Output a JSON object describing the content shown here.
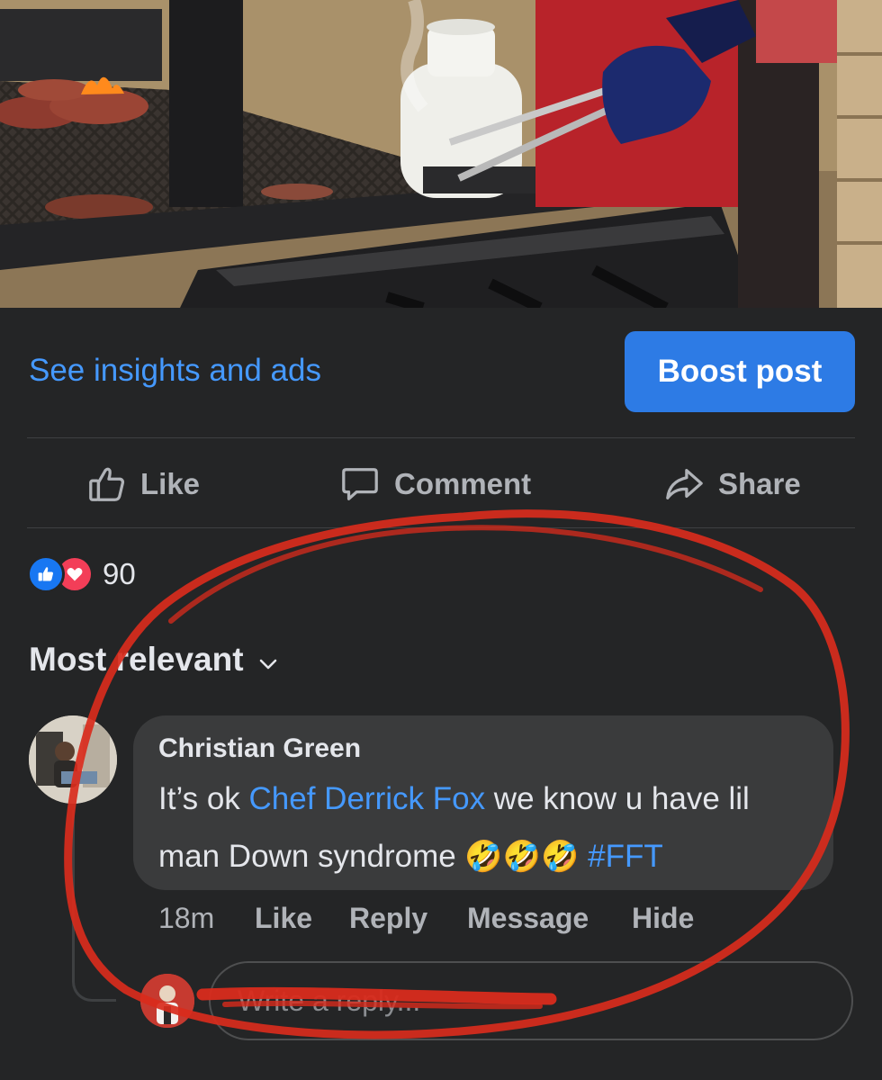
{
  "post": {
    "photo_alt": "",
    "insights_label": "See insights and ads",
    "boost_label": "Boost post"
  },
  "actions": {
    "like": "Like",
    "comment": "Comment",
    "share": "Share"
  },
  "reactions": {
    "types": [
      "like",
      "love"
    ],
    "count": "90"
  },
  "comments": {
    "sort_label": "Most relevant",
    "items": [
      {
        "author": "Christian Green",
        "text_prefix": "It’s ok ",
        "mention": "Chef Derrick Fox",
        "text_suffix": " we know u have lil man Down syndrome ",
        "emojis": "🤣🤣🤣",
        "hashtag": "#FFT",
        "time": "18m",
        "like_label": "Like",
        "reply_label": "Reply",
        "message_label": "Message",
        "hide_label": "Hide"
      }
    ],
    "reply_placeholder": "Write a reply..."
  },
  "colors": {
    "background": "#242526",
    "bubble": "#3a3b3c",
    "link": "#4599ff",
    "boost_button": "#2d7be5",
    "annotation_red": "#d92b1c"
  }
}
